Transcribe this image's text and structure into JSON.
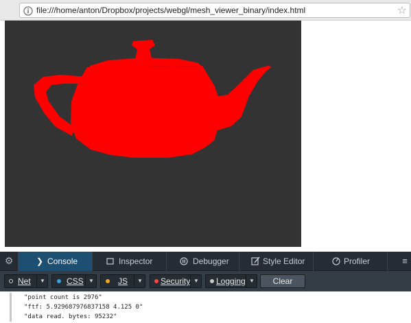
{
  "address_bar": {
    "url": "file:///home/anton/Dropbox/projects/webgl/mesh_viewer_binary/index.html",
    "page_icon": "page-icon",
    "bookmark_icon": "star-icon"
  },
  "viewport": {
    "background_color": "#333333",
    "model_color": "#ff0000"
  },
  "devtools": {
    "settings_icon": "gear-icon",
    "tabs": [
      {
        "label": "Console",
        "icon": "console-chevron-icon",
        "selected": true
      },
      {
        "label": "Inspector",
        "icon": "inspector-icon",
        "selected": false
      },
      {
        "label": "Debugger",
        "icon": "debugger-icon",
        "selected": false
      },
      {
        "label": "Style Editor",
        "icon": "style-editor-icon",
        "selected": false
      },
      {
        "label": "Profiler",
        "icon": "profiler-icon",
        "selected": false
      }
    ],
    "overflow_icon": "menu-icon",
    "filters": [
      {
        "label": "Net",
        "dot_color": "#d0d0d0"
      },
      {
        "label": "CSS",
        "dot_color": "#3aa3e3"
      },
      {
        "label": "JS",
        "dot_color": "#f5a623"
      },
      {
        "label": "Security",
        "dot_color": "#ff4444"
      },
      {
        "label": "Logging",
        "dot_color": "#c8c8c8"
      }
    ],
    "clear_label": "Clear",
    "console_output": [
      "\"point count is 2976\"",
      "\"ftf: 5.929687976837158 4.125 0\"",
      "\"data read. bytes: 95232\""
    ]
  }
}
